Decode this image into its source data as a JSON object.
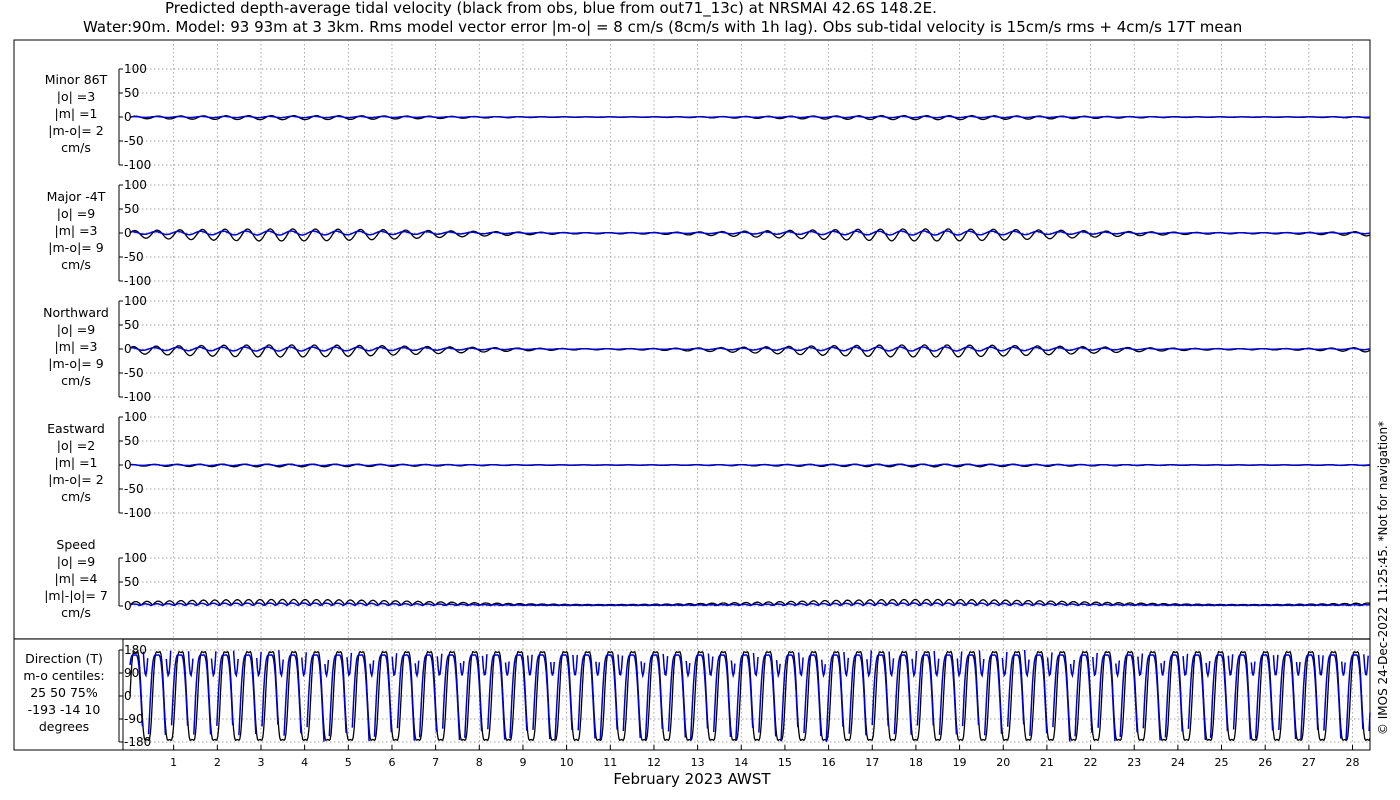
{
  "header": {
    "title_line1": "Predicted depth-average tidal velocity (black from obs, blue from out71_13c) at NRSMAI 42.6S 148.2E.",
    "title_line2": "Water:90m. Model: 93 93m at 3 3km. Rms model vector error |m-o| = 8 cm/s (8cm/s with 1h lag). Obs sub-tidal velocity is 15cm/s rms + 4cm/s 17T mean"
  },
  "xaxis": {
    "label": "February 2023 AWST",
    "ticks": [
      "1",
      "2",
      "3",
      "4",
      "5",
      "6",
      "7",
      "8",
      "9",
      "10",
      "11",
      "12",
      "13",
      "14",
      "15",
      "16",
      "17",
      "18",
      "19",
      "20",
      "21",
      "22",
      "23",
      "24",
      "25",
      "26",
      "27",
      "28"
    ]
  },
  "side_note": "© IMOS 24-Dec-2022 11:25:45. *Not for navigation*",
  "colors": {
    "obs": "#000000",
    "model": "#0000cc",
    "grid": "#888888"
  },
  "chart_data": [
    {
      "type": "line",
      "panel": "minor",
      "labels": [
        "Minor 86T",
        "|o| =3",
        "|m| =1",
        "|m-o|= 2",
        "cm/s"
      ],
      "yticks": [
        "100",
        "50",
        "0",
        "-50",
        "-100"
      ],
      "ylim": [
        -100,
        100
      ],
      "xlim": [
        0,
        28.4
      ],
      "grid": true,
      "series": [
        {
          "role": "obs",
          "amplitude": 3
        },
        {
          "role": "model",
          "amplitude": 1
        }
      ]
    },
    {
      "type": "line",
      "panel": "major",
      "labels": [
        "Major -4T",
        "|o| =9",
        "|m| =3",
        "|m-o|= 9",
        "cm/s"
      ],
      "yticks": [
        "100",
        "50",
        "0",
        "-50",
        "-100"
      ],
      "ylim": [
        -100,
        100
      ],
      "xlim": [
        0,
        28.4
      ],
      "grid": true,
      "series": [
        {
          "role": "obs",
          "amplitude": 9
        },
        {
          "role": "model",
          "amplitude": 3
        }
      ]
    },
    {
      "type": "line",
      "panel": "north",
      "labels": [
        "Northward",
        "|o| =9",
        "|m| =3",
        "|m-o|= 9",
        "cm/s"
      ],
      "yticks": [
        "100",
        "50",
        "0",
        "-50",
        "-100"
      ],
      "ylim": [
        -100,
        100
      ],
      "xlim": [
        0,
        28.4
      ],
      "grid": true,
      "series": [
        {
          "role": "obs",
          "amplitude": 9
        },
        {
          "role": "model",
          "amplitude": 3
        }
      ]
    },
    {
      "type": "line",
      "panel": "east",
      "labels": [
        "Eastward",
        "|o| =2",
        "|m| =1",
        "|m-o|= 2",
        "cm/s"
      ],
      "yticks": [
        "100",
        "50",
        "0",
        "-50",
        "-100"
      ],
      "ylim": [
        -100,
        100
      ],
      "xlim": [
        0,
        28.4
      ],
      "grid": true,
      "series": [
        {
          "role": "obs",
          "amplitude": 2
        },
        {
          "role": "model",
          "amplitude": 1
        }
      ]
    },
    {
      "type": "line",
      "panel": "speed",
      "labels": [
        "Speed",
        "|o| =9",
        "|m| =4",
        "|m|-|o|= 7",
        "cm/s"
      ],
      "yticks": [
        "100",
        "50",
        "0"
      ],
      "ylim": [
        0,
        100
      ],
      "xlim": [
        0,
        28.4
      ],
      "grid": true,
      "series": [
        {
          "role": "obs",
          "amplitude": 9
        },
        {
          "role": "model",
          "amplitude": 4
        }
      ]
    },
    {
      "type": "line",
      "panel": "direction",
      "labels": [
        "Direction (T)",
        "m-o centiles:",
        "25  50  75%",
        "-193  -14   10",
        "degrees"
      ],
      "yticks": [
        "180",
        "90",
        "0",
        "-90",
        "-180"
      ],
      "ylim": [
        -180,
        180
      ],
      "xlim": [
        0,
        28.4
      ],
      "grid": true,
      "series": [
        {
          "role": "obs"
        },
        {
          "role": "model"
        }
      ]
    }
  ]
}
